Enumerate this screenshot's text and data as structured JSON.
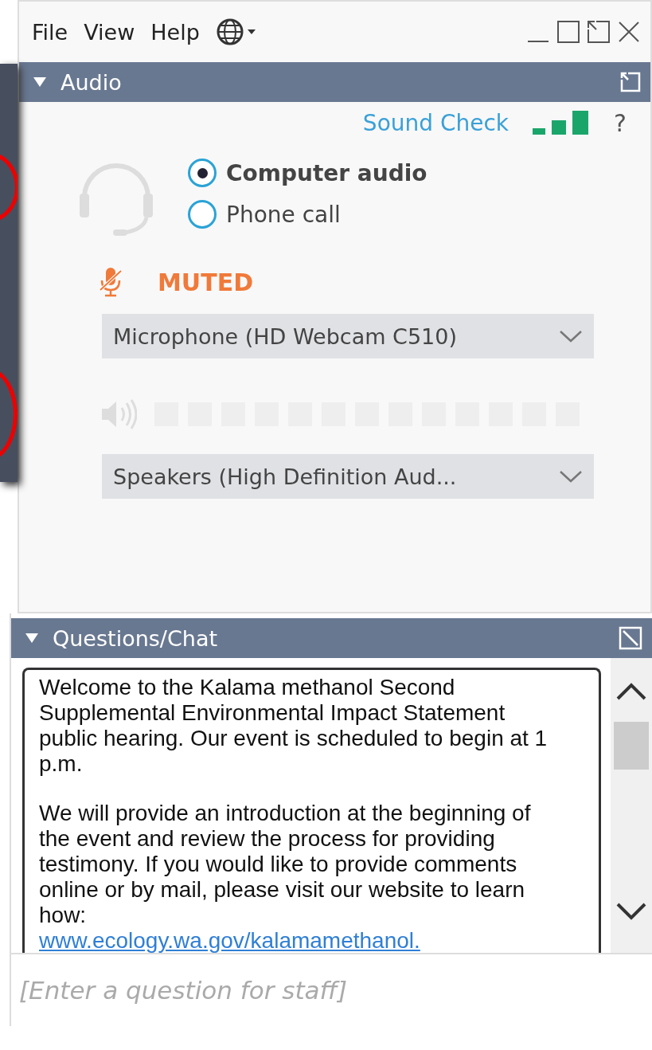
{
  "menu": [
    "File",
    "View",
    "Help"
  ],
  "audio": {
    "title": "Audio",
    "sound_check": "Sound Check",
    "help": "?",
    "options": [
      {
        "label": "Computer audio",
        "selected": true
      },
      {
        "label": "Phone call",
        "selected": false
      }
    ],
    "mic_status": "MUTED",
    "microphone": "Microphone (HD Webcam C510)",
    "speaker_meter": {
      "level": 0
    },
    "speakers": "Speakers (High Definition Aud..."
  },
  "chat": {
    "title": "Questions/Chat",
    "paragraphs": [
      "Welcome to the Kalama methanol Second Supplemental Environmental Impact Statement public hearing. Our event is scheduled to begin at 1 p.m.",
      "We will provide an introduction at the beginning of the event and review the process for providing testimony. If you would like to provide comments online or by mail, please visit our website to learn how:"
    ],
    "link": "www.ecology.wa.gov/kalamamethanol.",
    "placeholder": "[Enter a question for staff]"
  }
}
